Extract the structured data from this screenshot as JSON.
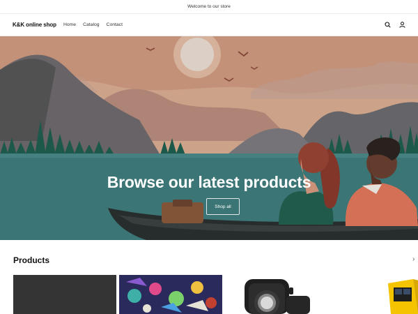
{
  "announcement": {
    "text": "Welcome to our store"
  },
  "header": {
    "logo": "K&K online shop",
    "nav": [
      {
        "label": "Home"
      },
      {
        "label": "Catalog"
      },
      {
        "label": "Contact"
      }
    ],
    "icons": [
      "search-icon",
      "account-icon"
    ]
  },
  "hero": {
    "heading": "Browse our latest products",
    "button_label": "Shop all",
    "image": "illustration of two people in a boat on a lake at sunset"
  },
  "products": {
    "title": "Products",
    "more_glyph": "›",
    "items": [
      {
        "image": "dark grey fabric"
      },
      {
        "image": "colorful comic-art print"
      },
      {
        "image": "black smartwatch"
      },
      {
        "image": "yellow solar power bank"
      }
    ]
  },
  "colors": {
    "sky": "#d9ad92",
    "water": "#3f7d7d",
    "boat": "#2a2f2f"
  }
}
